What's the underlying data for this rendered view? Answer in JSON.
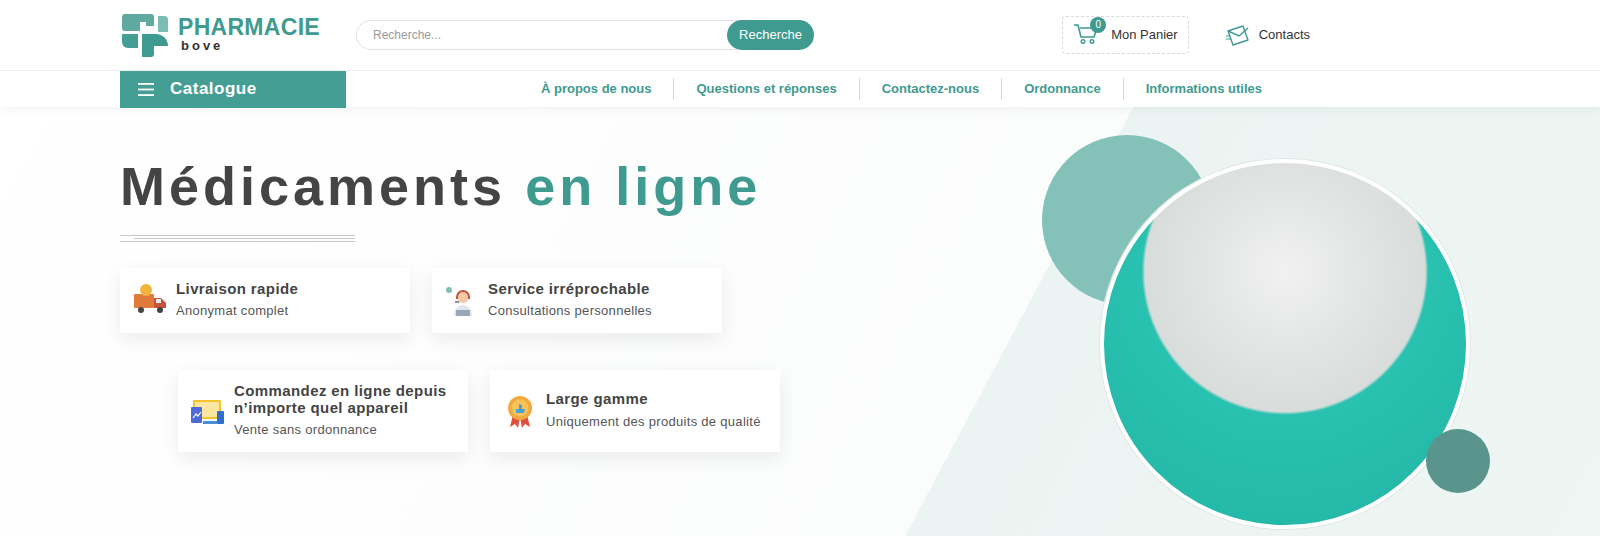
{
  "logo": {
    "title": "PHARMACIE",
    "subtitle": "bove"
  },
  "search": {
    "placeholder": "Recherche...",
    "button": "Recherche"
  },
  "cart": {
    "count": "0",
    "label": "Mon Panier"
  },
  "contacts": {
    "label": "Contacts"
  },
  "catalogue": {
    "label": "Catalogue"
  },
  "nav": [
    "À propos de nous",
    "Questions et réponses",
    "Contactez-nous",
    "Ordonnance",
    "Informations utiles"
  ],
  "hero": {
    "title_dark": "Médicaments",
    "title_accent": "en ligne"
  },
  "features": [
    {
      "title": "Livraison rapide",
      "subtitle": "Anonymat complet"
    },
    {
      "title": "Service irréprochable",
      "subtitle": "Consultations personnelles"
    },
    {
      "title": "Commandez en ligne depuis n’importe quel appareil",
      "subtitle": "Vente sans ordonnance"
    },
    {
      "title": "Large gamme",
      "subtitle": "Uniquement des produits de qualité"
    }
  ]
}
